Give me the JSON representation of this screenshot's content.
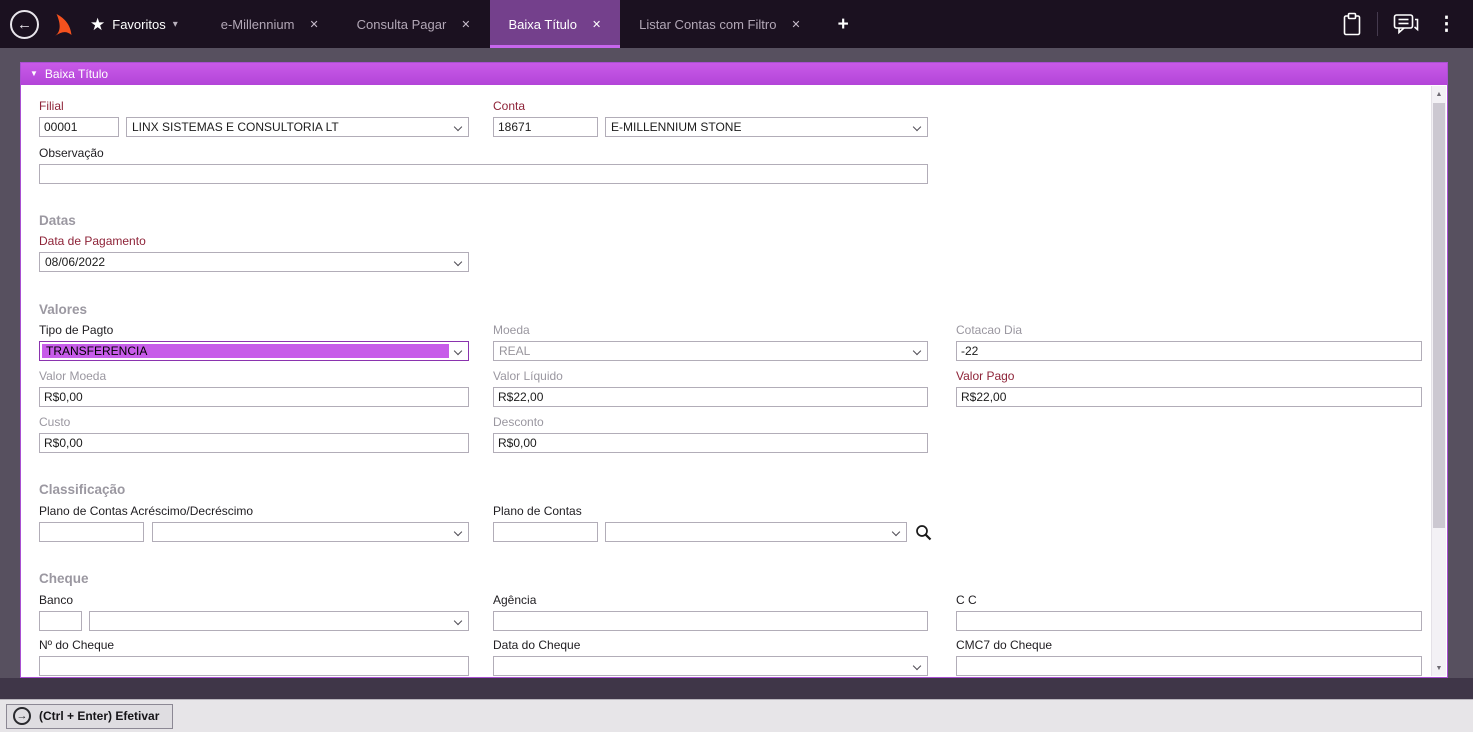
{
  "icons": {
    "back_arrow": "←",
    "star": "★",
    "caret": "▾",
    "close": "✕",
    "plus": "+",
    "dots": "⋮",
    "panel_caret": "▼",
    "scroll_up": "▲",
    "scroll_down": "▼",
    "efetivar_arrow": "→"
  },
  "topbar": {
    "favorites_label": "Favoritos",
    "tabs": [
      {
        "label": "e-Millennium",
        "active": false
      },
      {
        "label": "Consulta Pagar",
        "active": false
      },
      {
        "label": "Baixa Título",
        "active": true
      },
      {
        "label": "Listar Contas com Filtro",
        "active": false
      }
    ]
  },
  "panel": {
    "title": "Baixa Título"
  },
  "form": {
    "filial": {
      "label": "Filial",
      "code": "00001",
      "name": "LINX SISTEMAS E CONSULTORIA LT"
    },
    "conta": {
      "label": "Conta",
      "code": "18671",
      "name": "E-MILLENNIUM STONE"
    },
    "observacao": {
      "label": "Observação",
      "value": ""
    },
    "datas": {
      "heading": "Datas",
      "data_pagamento": {
        "label": "Data de Pagamento",
        "value": "08/06/2022"
      }
    },
    "valores": {
      "heading": "Valores",
      "tipo_pagto": {
        "label": "Tipo de Pagto",
        "value": "TRANSFERENCIA"
      },
      "moeda": {
        "label": "Moeda",
        "value": "REAL"
      },
      "cotacao_dia": {
        "label": "Cotacao Dia",
        "value": "-22"
      },
      "valor_moeda": {
        "label": "Valor Moeda",
        "value": "R$0,00"
      },
      "valor_liquido": {
        "label": "Valor Líquido",
        "value": "R$22,00"
      },
      "valor_pago": {
        "label": "Valor Pago",
        "value": "R$22,00"
      },
      "custo": {
        "label": "Custo",
        "value": "R$0,00"
      },
      "desconto": {
        "label": "Desconto",
        "value": "R$0,00"
      }
    },
    "classificacao": {
      "heading": "Classificação",
      "plano_acrescimo": {
        "label": "Plano de Contas Acréscimo/Decréscimo",
        "code": "",
        "name": ""
      },
      "plano_contas": {
        "label": "Plano de Contas",
        "code": "",
        "name": ""
      }
    },
    "cheque": {
      "heading": "Cheque",
      "banco": {
        "label": "Banco",
        "code": "",
        "name": ""
      },
      "agencia": {
        "label": "Agência",
        "value": ""
      },
      "cc": {
        "label": "C C",
        "value": ""
      },
      "num_cheque": {
        "label": "Nº do Cheque",
        "value": ""
      },
      "data_cheque": {
        "label": "Data do Cheque",
        "value": ""
      },
      "cmc7": {
        "label": "CMC7 do Cheque",
        "value": ""
      }
    }
  },
  "statusbar": {
    "efetivar_label": "(Ctrl + Enter) Efetivar"
  },
  "colors": {
    "topbar_bg": "#1b1120",
    "active_tab": "#74408c",
    "panel_accent": "#bb4be0",
    "selection_highlight": "#c75ce9",
    "label_red": "#8e2338",
    "background": "#57505f"
  }
}
